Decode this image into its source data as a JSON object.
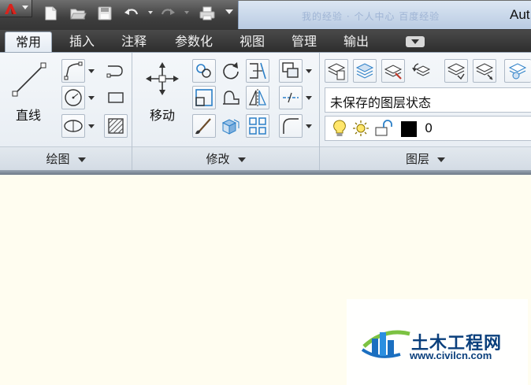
{
  "window": {
    "title_visible": "Aut",
    "blurred_title": "我的经验 · 个人中心 百度经验"
  },
  "ribbon_tabs": [
    {
      "label": "常用",
      "active": true
    },
    {
      "label": "插入",
      "active": false
    },
    {
      "label": "注释",
      "active": false
    },
    {
      "label": "参数化",
      "active": false
    },
    {
      "label": "视图",
      "active": false
    },
    {
      "label": "管理",
      "active": false
    },
    {
      "label": "输出",
      "active": false
    }
  ],
  "panels": {
    "draw": {
      "title": "绘图",
      "line_label": "直线"
    },
    "modify": {
      "title": "修改",
      "move_label": "移动"
    },
    "layers": {
      "title": "图层",
      "layer_state": "未保存的图层状态",
      "current_layer": "0",
      "layer_color": "#000000"
    }
  },
  "watermark": {
    "title": "土木工程网",
    "url": "www.civilcn.com"
  },
  "colors": {
    "canvas_bg": "#fffdf0",
    "brand": "#0a3f7c",
    "accent_icon": "#2b7fc7"
  }
}
